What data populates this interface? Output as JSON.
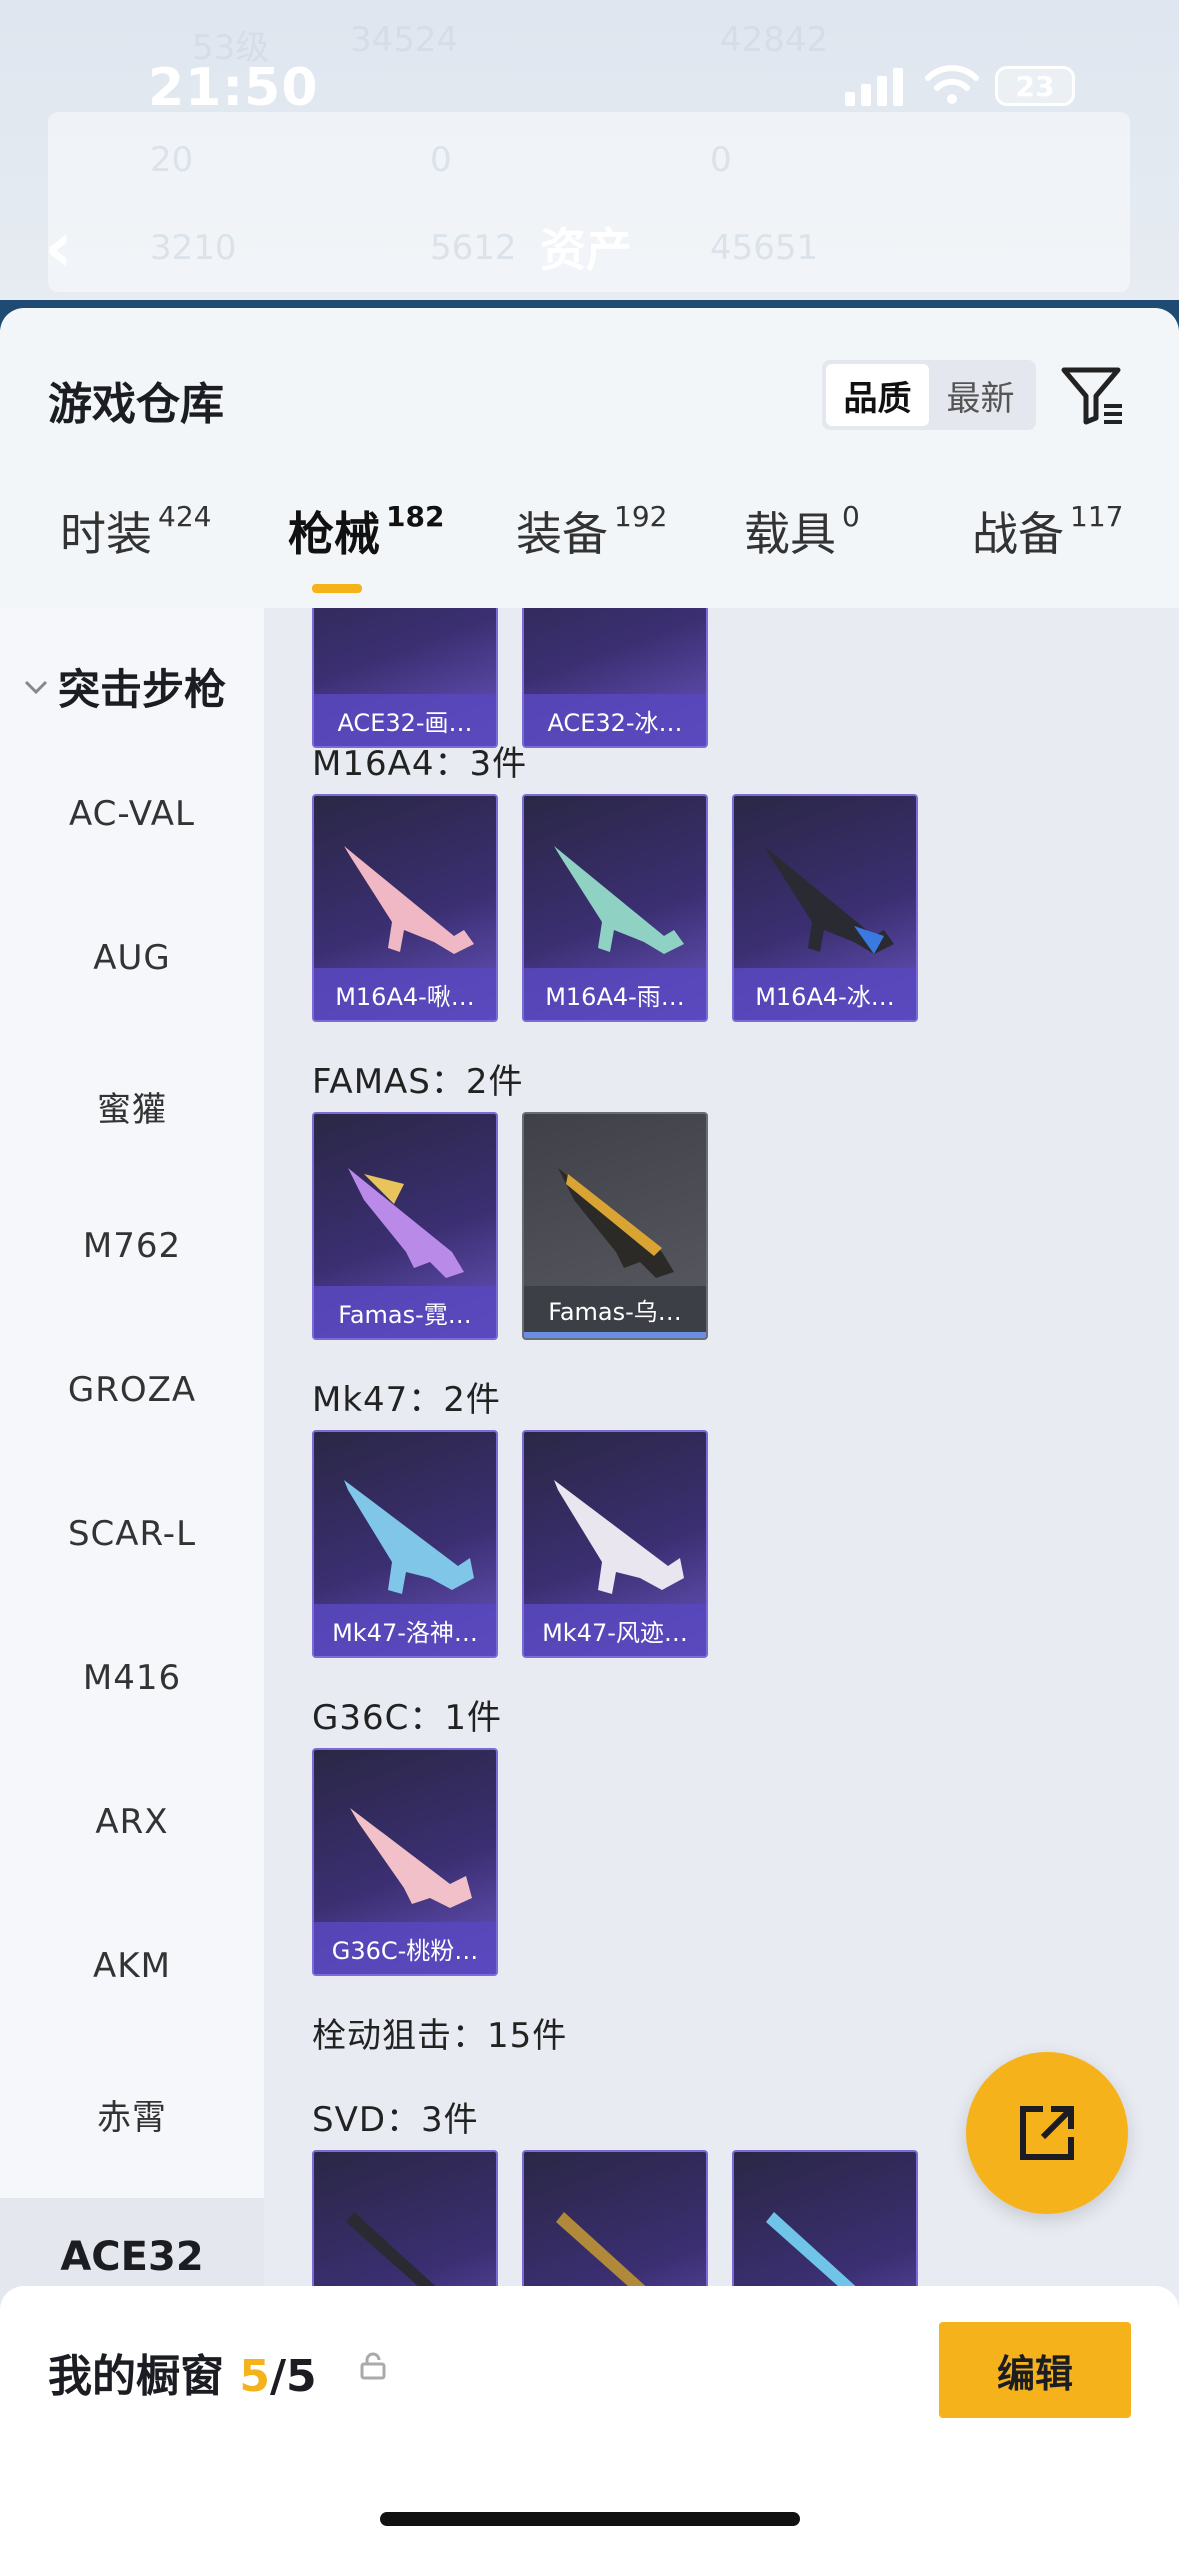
{
  "status": {
    "time": "21:50",
    "battery": "23"
  },
  "header": {
    "title": "资产",
    "ghost": [
      "53级",
      "34524",
      "42842",
      "20",
      "0",
      "0",
      "3210",
      "5612",
      "45651"
    ]
  },
  "sheet": {
    "title": "游戏仓库",
    "sort": [
      "品质",
      "最新"
    ],
    "tabs": [
      {
        "label": "时装",
        "count": "424"
      },
      {
        "label": "枪械",
        "count": "182"
      },
      {
        "label": "装备",
        "count": "192"
      },
      {
        "label": "载具",
        "count": "0"
      },
      {
        "label": "战备",
        "count": "117"
      }
    ]
  },
  "sidebar": {
    "header": "突击步枪",
    "items": [
      "AC-VAL",
      "AUG",
      "蜜獾",
      "M762",
      "GROZA",
      "SCAR-L",
      "M416",
      "ARX",
      "AKM",
      "赤霄"
    ],
    "active": "ACE32"
  },
  "content": {
    "top_cards": [
      "ACE32-画…",
      "ACE32-冰…"
    ],
    "groups": [
      {
        "title": "M16A4：3件",
        "cards": [
          "M16A4-啾…",
          "M16A4-雨…",
          "M16A4-冰…"
        ]
      },
      {
        "title": "FAMAS：2件",
        "cards": [
          "Famas-霓…",
          "Famas-乌…"
        ]
      },
      {
        "title": "Mk47：2件",
        "cards": [
          "Mk47-洛神…",
          "Mk47-风迹…"
        ]
      },
      {
        "title": "G36C：1件",
        "cards": [
          "G36C-桃粉…"
        ]
      }
    ],
    "section": "栓动狙击：15件",
    "svd_title": "SVD：3件"
  },
  "bottom": {
    "title": "我的橱窗",
    "count": "5",
    "total": "/5",
    "edit": "编辑"
  },
  "colors": {
    "accent": "#f5b21b",
    "card_purple": "#3b2f72",
    "card_border": "#7c6ad8"
  }
}
